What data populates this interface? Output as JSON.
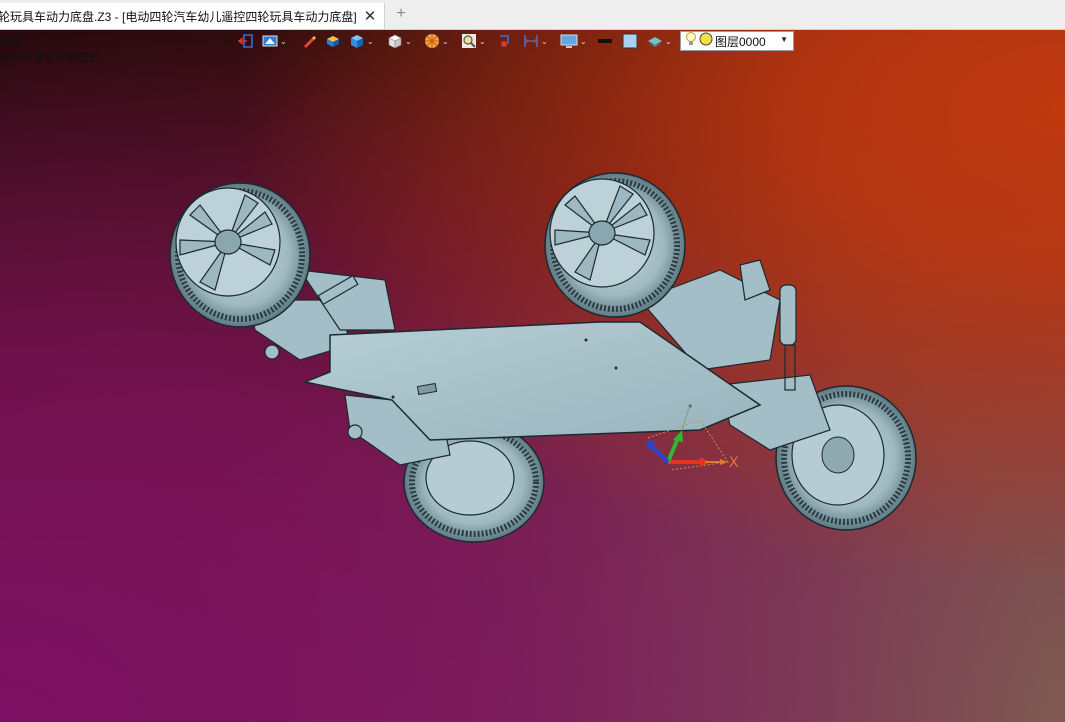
{
  "tab": {
    "title": "轮玩具车动力底盘.Z3 - [电动四轮汽车幼儿遥控四轮玩具车动力底盘]",
    "close_glyph": "✕",
    "new_tab_glyph": "+"
  },
  "prompts": {
    "line1": "快捷",
    "line2": "鼠标中键或右键提示."
  },
  "toolbar": {
    "icons": [
      "exit-icon",
      "view-icon",
      "pencil-icon",
      "shaded-box-icon",
      "blue-cube-icon",
      "white-cube-icon",
      "render-style-icon",
      "zoom-icon",
      "select-filter-icon",
      "dimension-icon",
      "display-icon",
      "black-rect-icon",
      "color-swatch-icon",
      "layers-icon"
    ],
    "layer": {
      "name": "图层0000",
      "bulb_color": "#f2d23c",
      "dot_color": "#f0e040"
    }
  },
  "triad": {
    "x_label": "X",
    "colors": {
      "x": "#e53224",
      "y": "#2fb82f",
      "z": "#2b46c8"
    }
  },
  "background": {
    "top_left": "#1e0808",
    "top_right": "#c0390f",
    "bottom_left": "#7c1062",
    "bottom_right": "#7e5a52"
  },
  "model": {
    "body_color": "#a9c3cc",
    "edge_color": "#1a2a30"
  }
}
